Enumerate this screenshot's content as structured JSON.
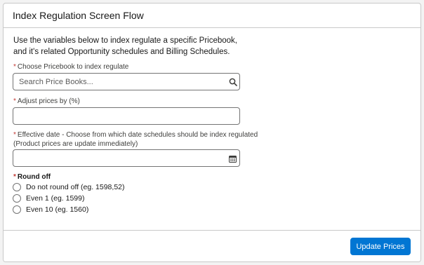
{
  "header": {
    "title": "Index Regulation Screen Flow"
  },
  "intro": "Use the variables below to index regulate a specific Pricebook, and it's related Opportunity schedules and Billing Schedules.",
  "fields": {
    "pricebook": {
      "required_mark": "*",
      "label": "Choose Pricebook to index regulate",
      "placeholder": "Search Price Books...",
      "value": ""
    },
    "adjust": {
      "required_mark": "*",
      "label": "Adjust prices by (%)",
      "value": ""
    },
    "effective_date": {
      "required_mark": "*",
      "label": "Effective date - Choose from which date schedules should be index regulated",
      "sublabel": "(Product prices are update immediately)",
      "value": ""
    }
  },
  "round_off": {
    "required_mark": "*",
    "label": "Round off",
    "options": [
      "Do not round off (eg. 1598,52)",
      "Even 1 (eg. 1599)",
      "Even 10 (eg. 1560)"
    ]
  },
  "footer": {
    "button_label": "Update Prices"
  },
  "colors": {
    "brand": "#0176d3",
    "required": "#c23934",
    "border": "#c9c9c9"
  },
  "icons": {
    "search": "search-icon",
    "calendar": "calendar-icon"
  }
}
